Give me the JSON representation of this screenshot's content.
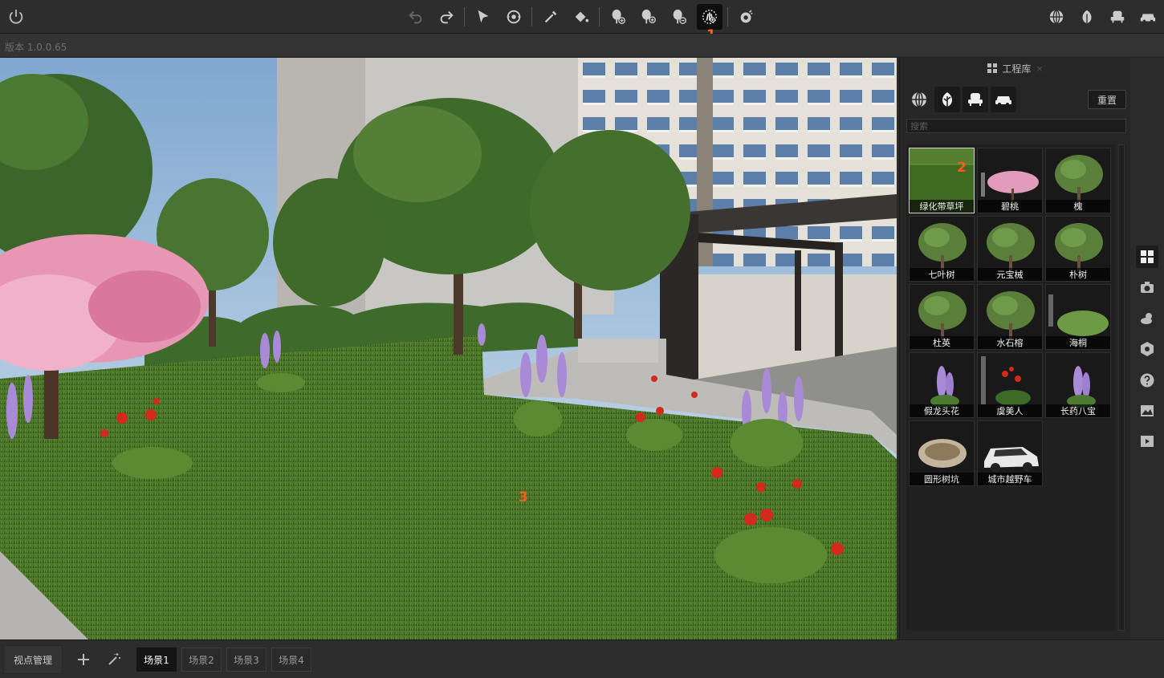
{
  "app": {
    "version": "版本 1.0.0.65"
  },
  "markers": {
    "m1": "1",
    "m2": "2",
    "m3": "3"
  },
  "toolbar": {
    "left": [
      "power-icon"
    ],
    "center": [
      "undo-icon",
      "redo-icon",
      "select-arrow-icon",
      "orbit-icon",
      "eyedropper-icon",
      "paint-bucket-icon",
      "tree-add-icon",
      "tree-add-multi-icon",
      "tree-remove-icon",
      "grass-brush-icon",
      "weather-icon"
    ],
    "right": [
      "globe-icon",
      "plant-library-icon",
      "furniture-icon",
      "car-icon"
    ],
    "active": "grass-brush-icon"
  },
  "library": {
    "title": "工程库",
    "close": "×",
    "reset_label": "重置",
    "search_placeholder": "搜索",
    "categories": [
      "globe-icon",
      "plant-icon",
      "furniture-icon",
      "car-icon"
    ],
    "selected_category": "plant-icon",
    "assets": [
      {
        "name": "绿化带草坪",
        "kind": "grass"
      },
      {
        "name": "碧桃",
        "kind": "peach"
      },
      {
        "name": "槐",
        "kind": "tree"
      },
      {
        "name": "七叶树",
        "kind": "tree"
      },
      {
        "name": "元宝械",
        "kind": "tree"
      },
      {
        "name": "朴树",
        "kind": "tree"
      },
      {
        "name": "杜英",
        "kind": "tree"
      },
      {
        "name": "水石榕",
        "kind": "tree"
      },
      {
        "name": "海桐",
        "kind": "shrub"
      },
      {
        "name": "假龙头花",
        "kind": "flower"
      },
      {
        "name": "虞美人",
        "kind": "poppy"
      },
      {
        "name": "长药八宝",
        "kind": "flower"
      },
      {
        "name": "圆形树坑",
        "kind": "pit"
      },
      {
        "name": "城市越野车",
        "kind": "car"
      }
    ],
    "selected_asset": "绿化带草坪"
  },
  "rightbar": [
    "grid-icon",
    "camera-icon",
    "weather-icon",
    "settings-icon",
    "help-icon",
    "image-icon",
    "video-icon"
  ],
  "bottom": {
    "viewpoint_label": "视点管理",
    "scenes": [
      "场景1",
      "场景2",
      "场景3",
      "场景4"
    ],
    "active_scene": "场景1"
  },
  "colors": {
    "accent_marker": "#ff5a1f",
    "panel_bg": "#262626",
    "toolbar_bg": "#2d2d2d"
  }
}
